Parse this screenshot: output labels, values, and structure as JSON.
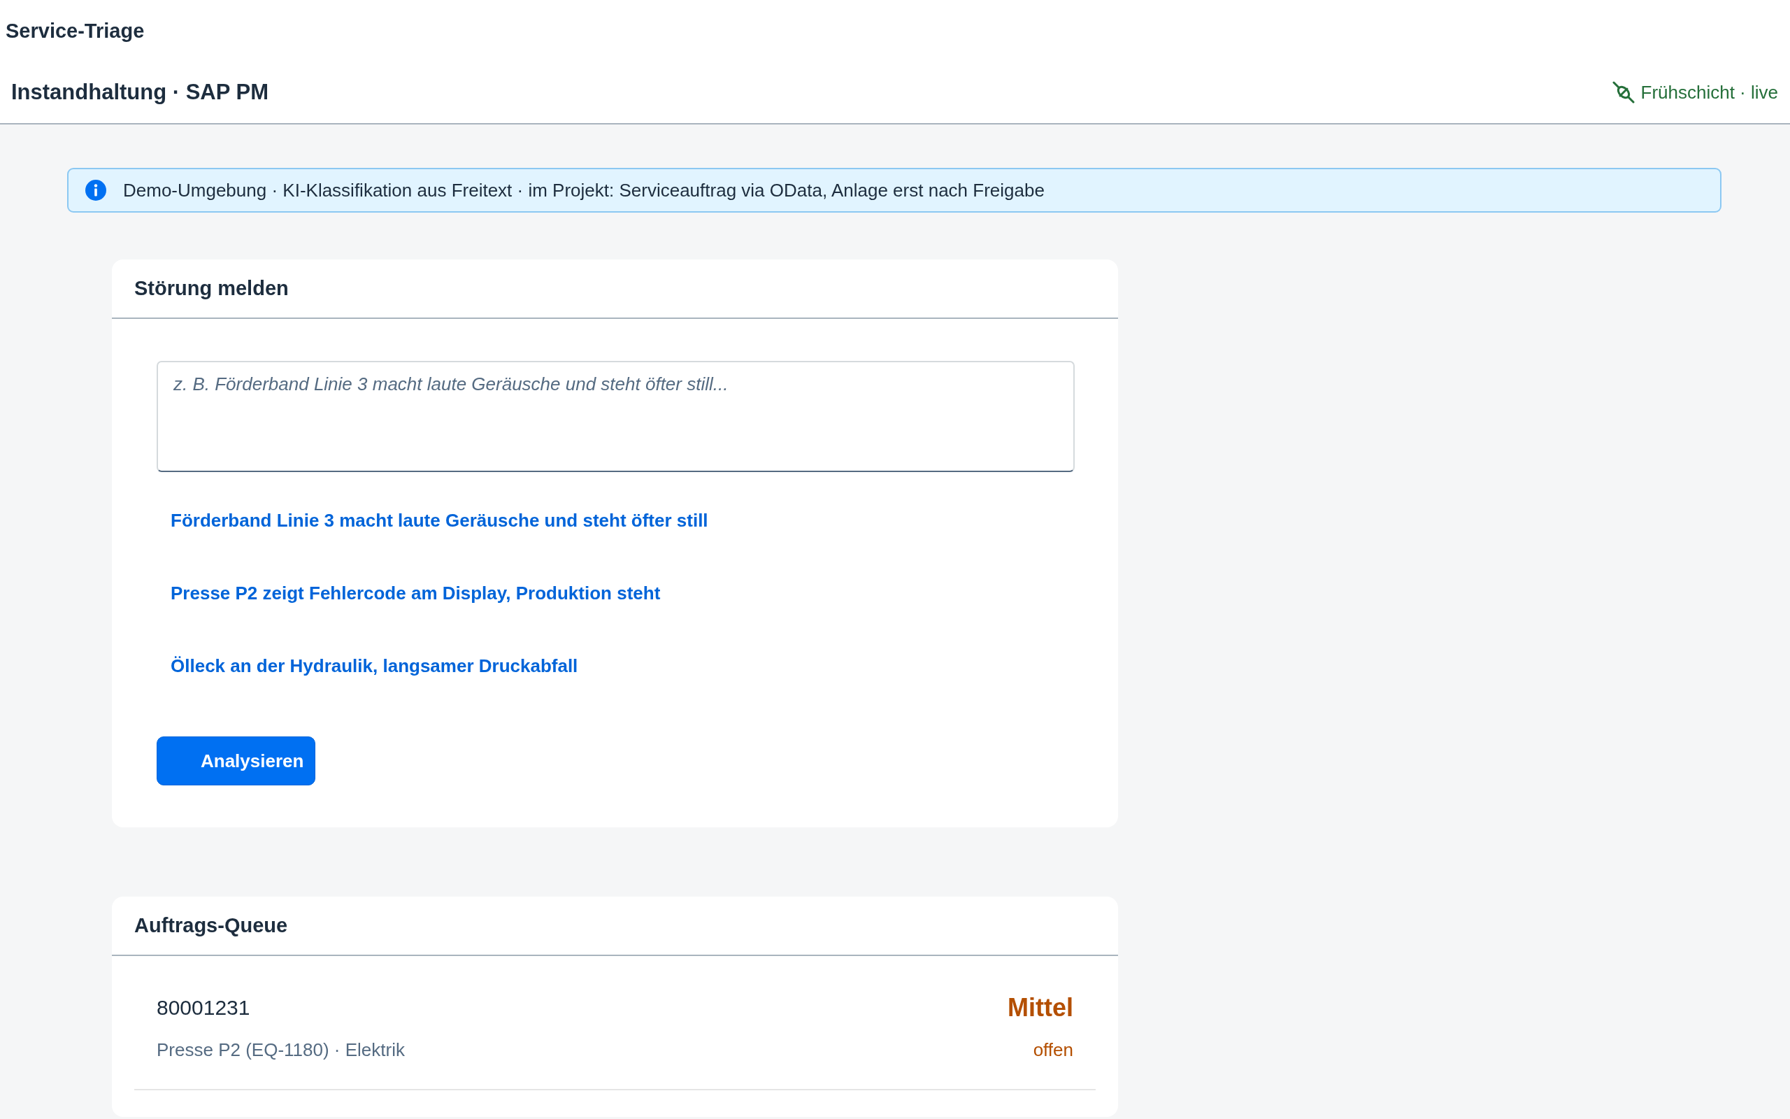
{
  "header": {
    "title": "Service-Triage",
    "subtitle": "Instandhaltung · SAP PM",
    "status": "Frühschicht · live"
  },
  "info_banner": {
    "text": "Demo-Umgebung · KI-Klassifikation aus Freitext · im Projekt: Serviceauftrag via OData, Anlage erst nach Freigabe"
  },
  "report_card": {
    "title": "Störung melden",
    "description_field": {
      "placeholder": "z. B. Förderband Linie 3 macht laute Geräusche und steht öfter still..."
    },
    "suggestions": [
      "Förderband Linie 3 macht laute Geräusche und steht öfter still",
      "Presse P2 zeigt Fehlercode am Display, Produktion steht",
      "Ölleck an der Hydraulik, langsamer Druckabfall"
    ],
    "analyze_button": "Analysieren"
  },
  "queue_card": {
    "title": "Auftrags-Queue",
    "orders": [
      {
        "number": "80001231",
        "details": "Presse P2 (EQ-1180) · Elektrik",
        "priority": "Mittel",
        "status": "offen",
        "color": "#b44f00"
      }
    ]
  }
}
